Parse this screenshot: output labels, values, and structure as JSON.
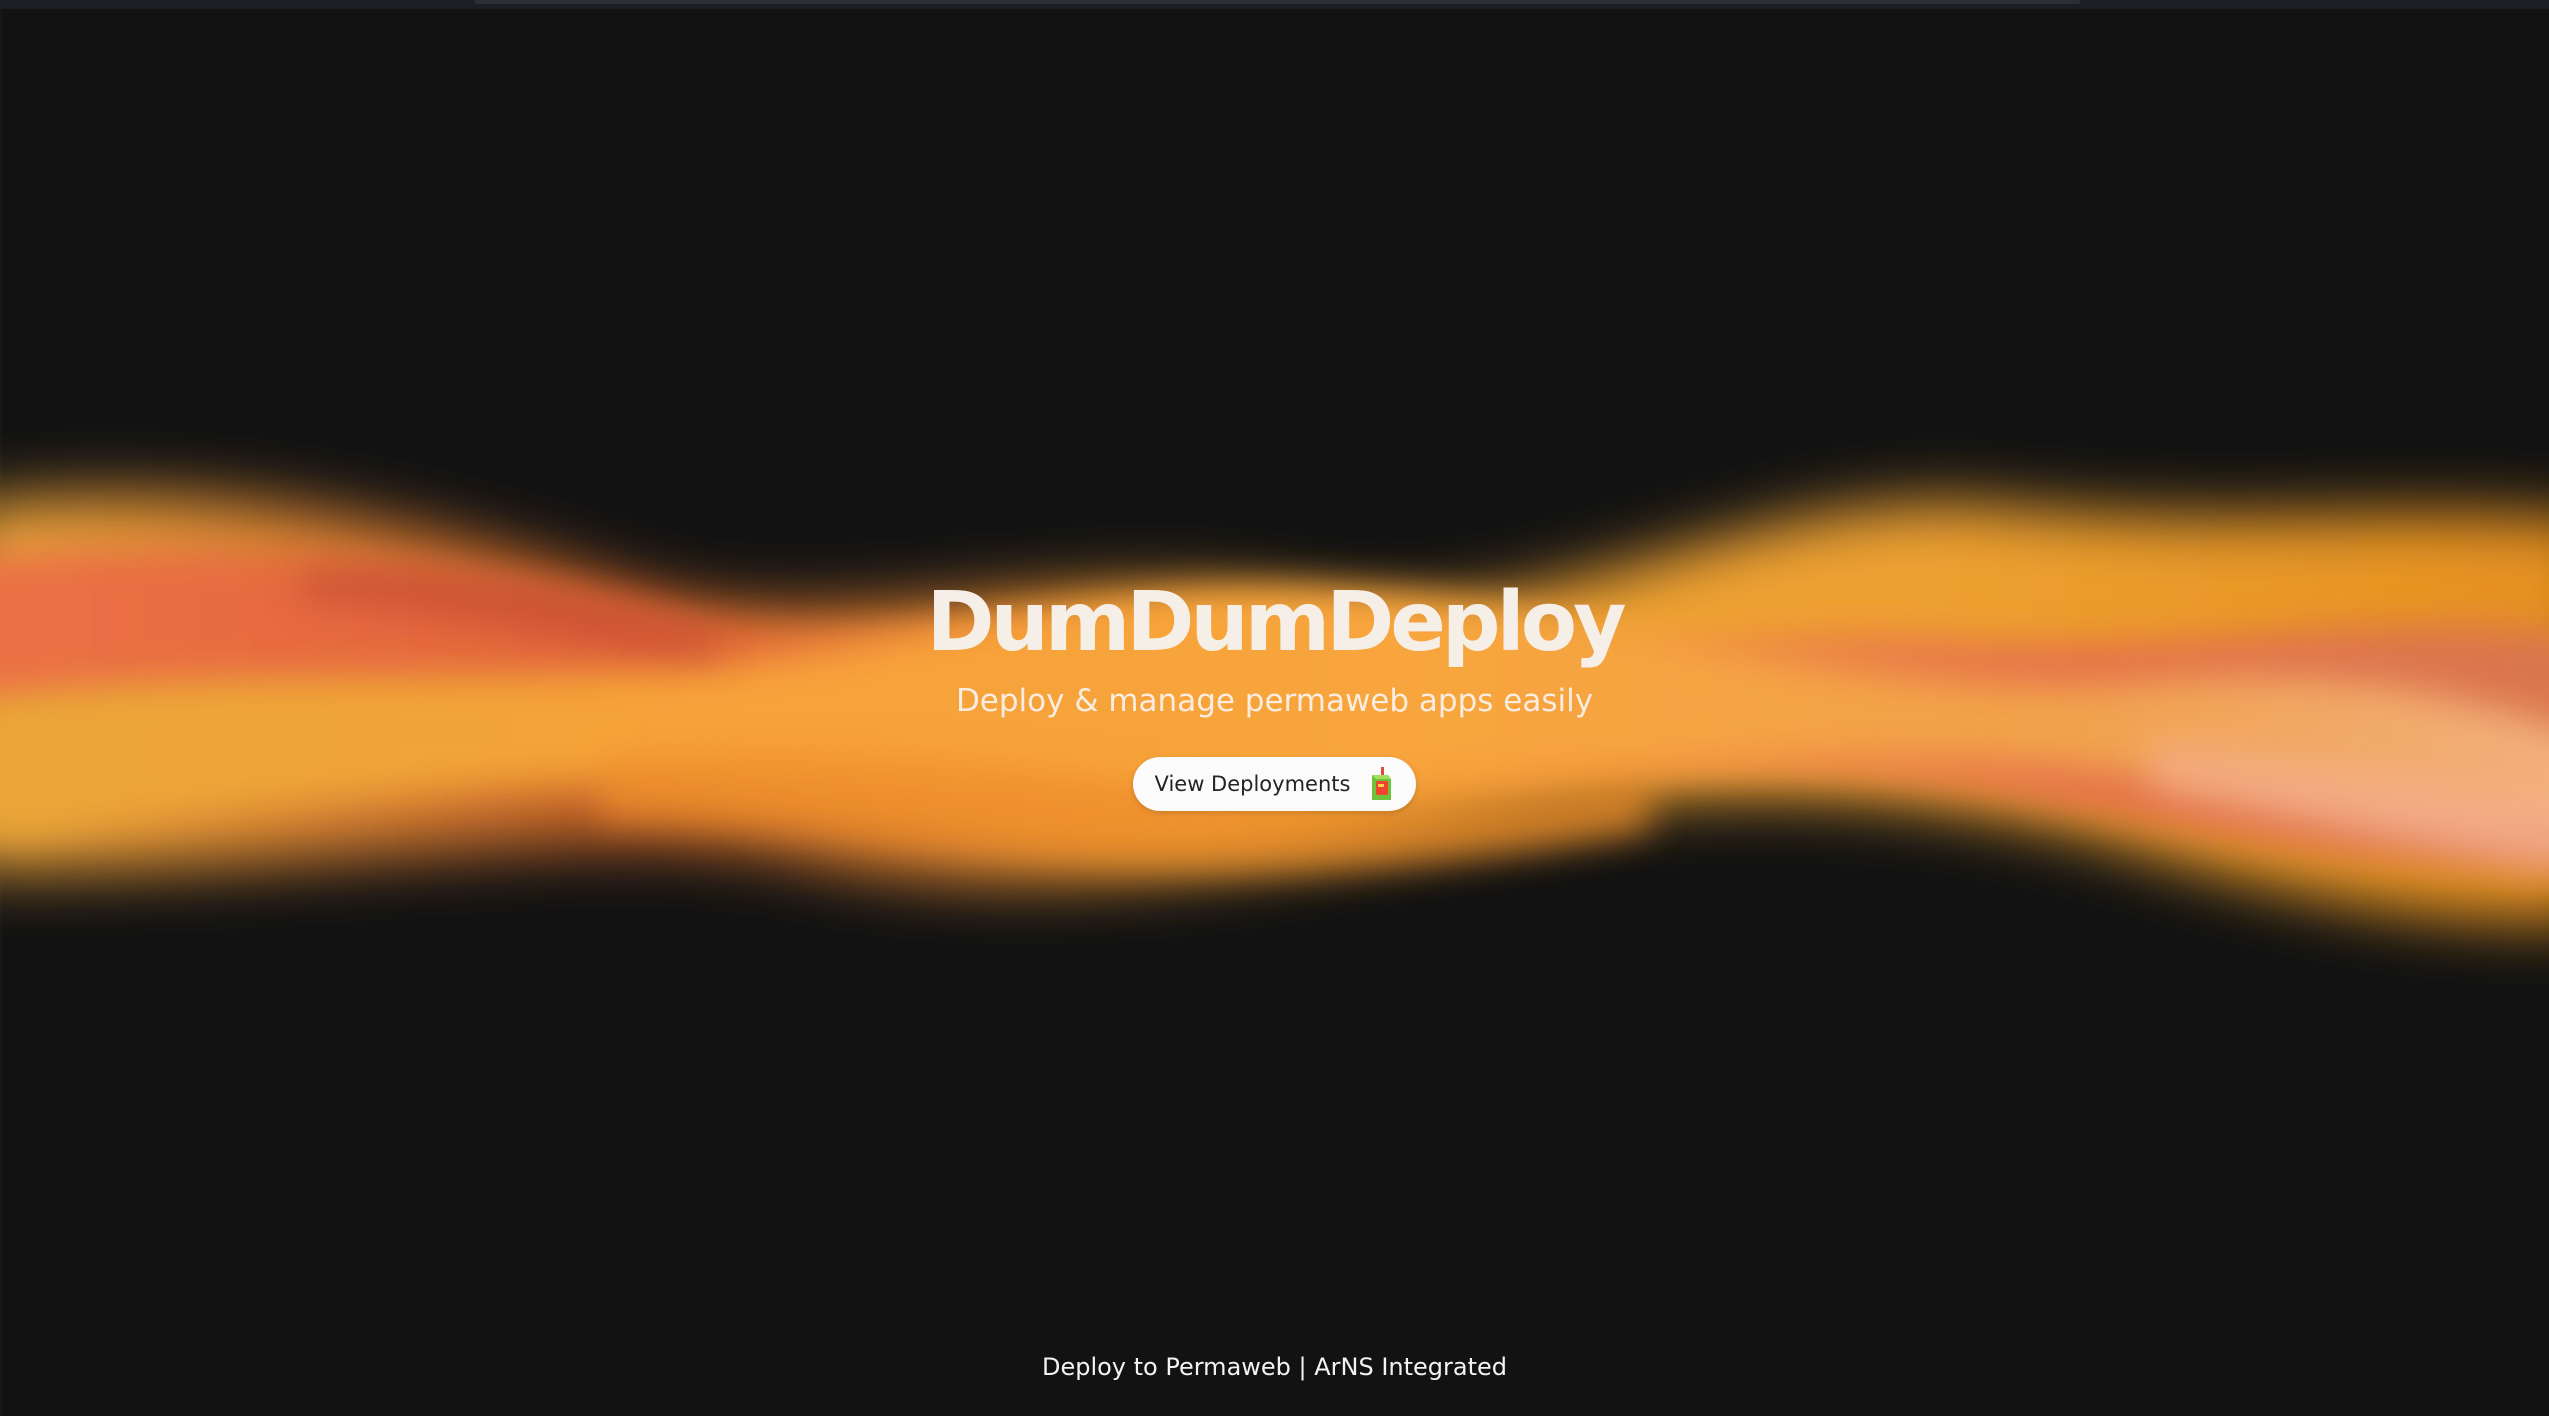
{
  "hero": {
    "title": "DumDumDeploy",
    "subtitle": "Deploy & manage permaweb apps easily"
  },
  "cta": {
    "label": "View Deployments",
    "icon": "juice-box-icon"
  },
  "footer": {
    "text": "Deploy to Permaweb | ArNS Integrated"
  },
  "colors": {
    "background": "#121212",
    "wave_orange": "#f59a2f",
    "wave_red": "#e5603e",
    "wave_gold": "#e8a232",
    "text": "#f6efe8"
  }
}
